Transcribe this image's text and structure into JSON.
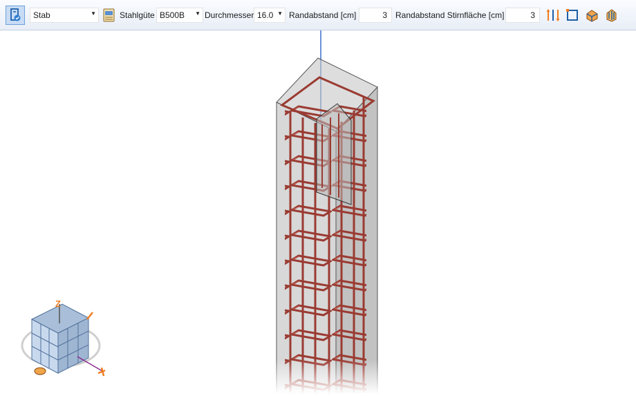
{
  "toolbar": {
    "bar_type": {
      "value": "Stab",
      "icon": "reinforcement-icon"
    },
    "steel_grade": {
      "label": "Stahlgüte",
      "value": "B500B",
      "icon": "steel-grade-icon"
    },
    "diameter": {
      "label": "Durchmesser",
      "value": "16.0"
    },
    "edge_distance": {
      "label": "Randabstand [cm]",
      "value": "3"
    },
    "end_face_distance": {
      "label": "Randabstand Stirnfläche [cm]",
      "value": "3"
    },
    "tools": [
      {
        "name": "bar-direction-icon"
      },
      {
        "name": "rectangle-frame-icon"
      },
      {
        "name": "shape-tool-icon"
      },
      {
        "name": "shape-tool-alt-icon"
      }
    ]
  },
  "colors": {
    "rebar": "#9a3b32",
    "concrete_fill": "#cfcfcf",
    "axis_line": "#3a6fc8",
    "accent_orange": "#f07d22",
    "toolbar_bg": "#edf2f9"
  }
}
